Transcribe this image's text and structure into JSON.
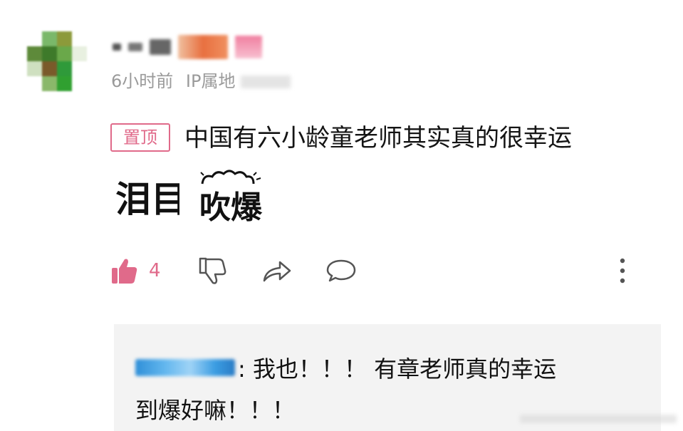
{
  "comment": {
    "time": "6小时前",
    "ip_label": "IP属地",
    "pin_badge": "置顶",
    "text": "中国有六小龄童老师其实真的很幸运",
    "emoji_1_text": "泪目",
    "emoji_2_text": "吹爆",
    "like_count": "4"
  },
  "actions": {
    "like_icon": "thumbs-up-icon",
    "dislike_icon": "thumbs-down-icon",
    "share_icon": "share-icon",
    "reply_icon": "comment-bubble-icon",
    "more_icon": "more-vertical-icon"
  },
  "reply": {
    "text_line1": ": 我也！！！ 有章老师真的幸运",
    "text_line2": "到爆好嘛！！！"
  },
  "colors": {
    "accent": "#e06a8a",
    "meta_text": "#9a9a9a",
    "reply_bg": "#f3f3f3"
  }
}
